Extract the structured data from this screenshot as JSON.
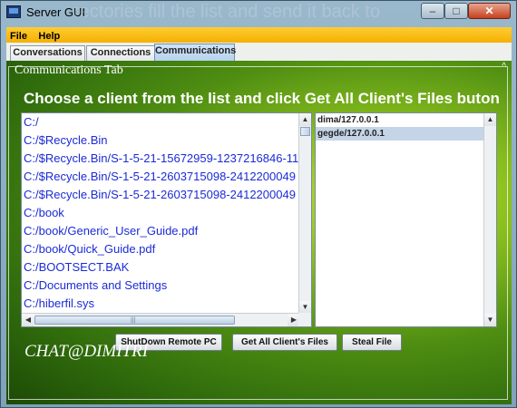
{
  "window": {
    "title": "Server GUI",
    "background_text": "rectories fill the list and send it back to",
    "controls": {
      "minimize": "–",
      "maximize": "□",
      "close": "✕"
    }
  },
  "menubar": {
    "items": [
      "File",
      "Help"
    ]
  },
  "tabs": [
    {
      "label": "Conversations",
      "selected": false
    },
    {
      "label": "Connections",
      "selected": false
    },
    {
      "label": "Communications",
      "selected": true
    }
  ],
  "panel": {
    "title": "Communications Tab",
    "corner_mark": "^",
    "instructions": "Choose a client from the list and click Get All Client's Files buton"
  },
  "file_list": {
    "items": [
      "C:/",
      "C:/$Recycle.Bin",
      "C:/$Recycle.Bin/S-1-5-21-15672959-1237216846-11",
      "C:/$Recycle.Bin/S-1-5-21-2603715098-2412200049",
      "C:/$Recycle.Bin/S-1-5-21-2603715098-2412200049",
      "C:/book",
      "C:/book/Generic_User_Guide.pdf",
      "C:/book/Quick_Guide.pdf",
      "C:/BOOTSECT.BAK",
      "C:/Documents and Settings",
      "C:/hiberfil.sys"
    ]
  },
  "client_list": {
    "items": [
      {
        "label": "dima/127.0.0.1",
        "selected": false
      },
      {
        "label": "gegde/127.0.0.1",
        "selected": true
      }
    ]
  },
  "buttons": {
    "shutdown": "ShutDown Remote PC",
    "get_all": "Get All Client's Files",
    "steal": "Steal File"
  },
  "chat_label": "CHAT@DIMITRI",
  "colors": {
    "menubar": "#f5b000",
    "file_text": "#1b2bd6",
    "selected_row": "#c5d4e6",
    "panel_bg": "#4f8e12"
  }
}
